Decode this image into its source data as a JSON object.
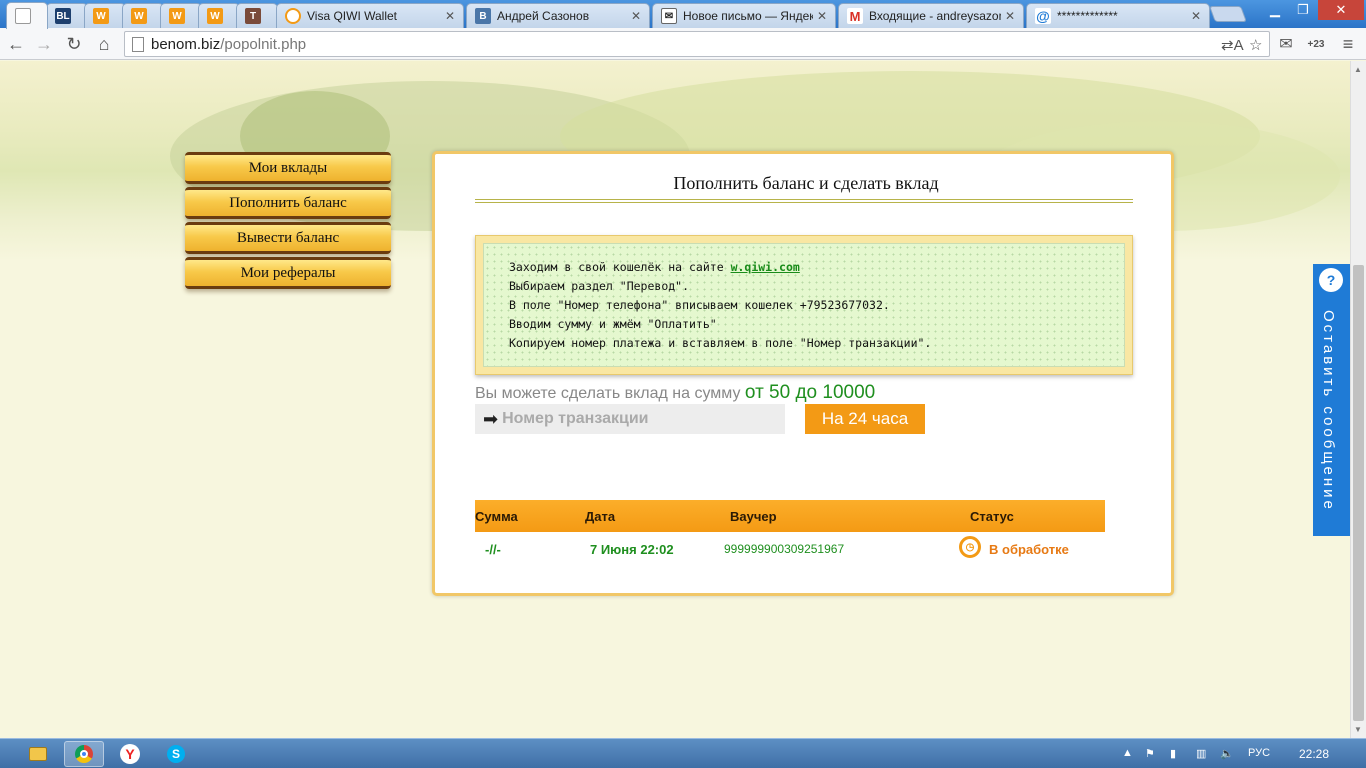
{
  "browser": {
    "tabs": [
      {
        "title": "",
        "favicon": "blank-page-icon",
        "active": true
      },
      {
        "title": "",
        "favicon": "BL"
      },
      {
        "title": "",
        "favicon": "W"
      },
      {
        "title": "",
        "favicon": "W"
      },
      {
        "title": "",
        "favicon": "W"
      },
      {
        "title": "",
        "favicon": "W"
      },
      {
        "title": "",
        "favicon": "T"
      },
      {
        "title": "Visa QIWI Wallet",
        "favicon": "qiwi-icon"
      },
      {
        "title": "Андрей Сазонов",
        "favicon": "В"
      },
      {
        "title": "Новое письмо — Яндекс",
        "favicon": "yandex-mail-icon"
      },
      {
        "title": "Входящие - andreysazon",
        "favicon": "M"
      },
      {
        "title": "*************",
        "favicon": "@"
      }
    ],
    "url_host": "benom.biz",
    "url_path": "/popolnit.php",
    "ext_badge": "+23"
  },
  "sidebar": {
    "items": [
      {
        "label": "Мои вклады"
      },
      {
        "label": "Пополнить баланс"
      },
      {
        "label": "Вывести баланс"
      },
      {
        "label": "Мои рефералы"
      }
    ]
  },
  "panel": {
    "title": "Пополнить баланс и сделать вклад",
    "instructions": {
      "line1_prefix": "Заходим в свой кошелёк на сайте ",
      "line1_link": "w.qiwi.com",
      "line2": "Выбираем раздел \"Перевод\".",
      "line3": "В поле \"Номер телефона\" вписываем кошелек +79523677032.",
      "line4": "Вводим сумму и жмём \"Оплатить\"",
      "line5": "Копируем номер платежа и вставляем в поле \"Номер транзакции\"."
    },
    "sum_prefix": "Вы можете сделать вклад на сумму ",
    "sum_range": "от 50 до 10000",
    "txn_placeholder": "Номер транзакции",
    "submit_label": "На 24 часа",
    "table": {
      "headers": [
        "Сумма",
        "Дата",
        "Ваучер",
        "Статус"
      ],
      "rows": [
        {
          "sum": "-//-",
          "date": "7 Июня 22:02",
          "voucher": "999999900309251967",
          "status": "В обработке"
        }
      ]
    }
  },
  "feedback": {
    "label": "Оставить сообщение"
  },
  "taskbar": {
    "lang": "РУС",
    "time": "22:28"
  },
  "colors": {
    "accent_orange": "#f39a15",
    "green": "#1f8f1f",
    "feedback_blue": "#1f7bd6"
  }
}
